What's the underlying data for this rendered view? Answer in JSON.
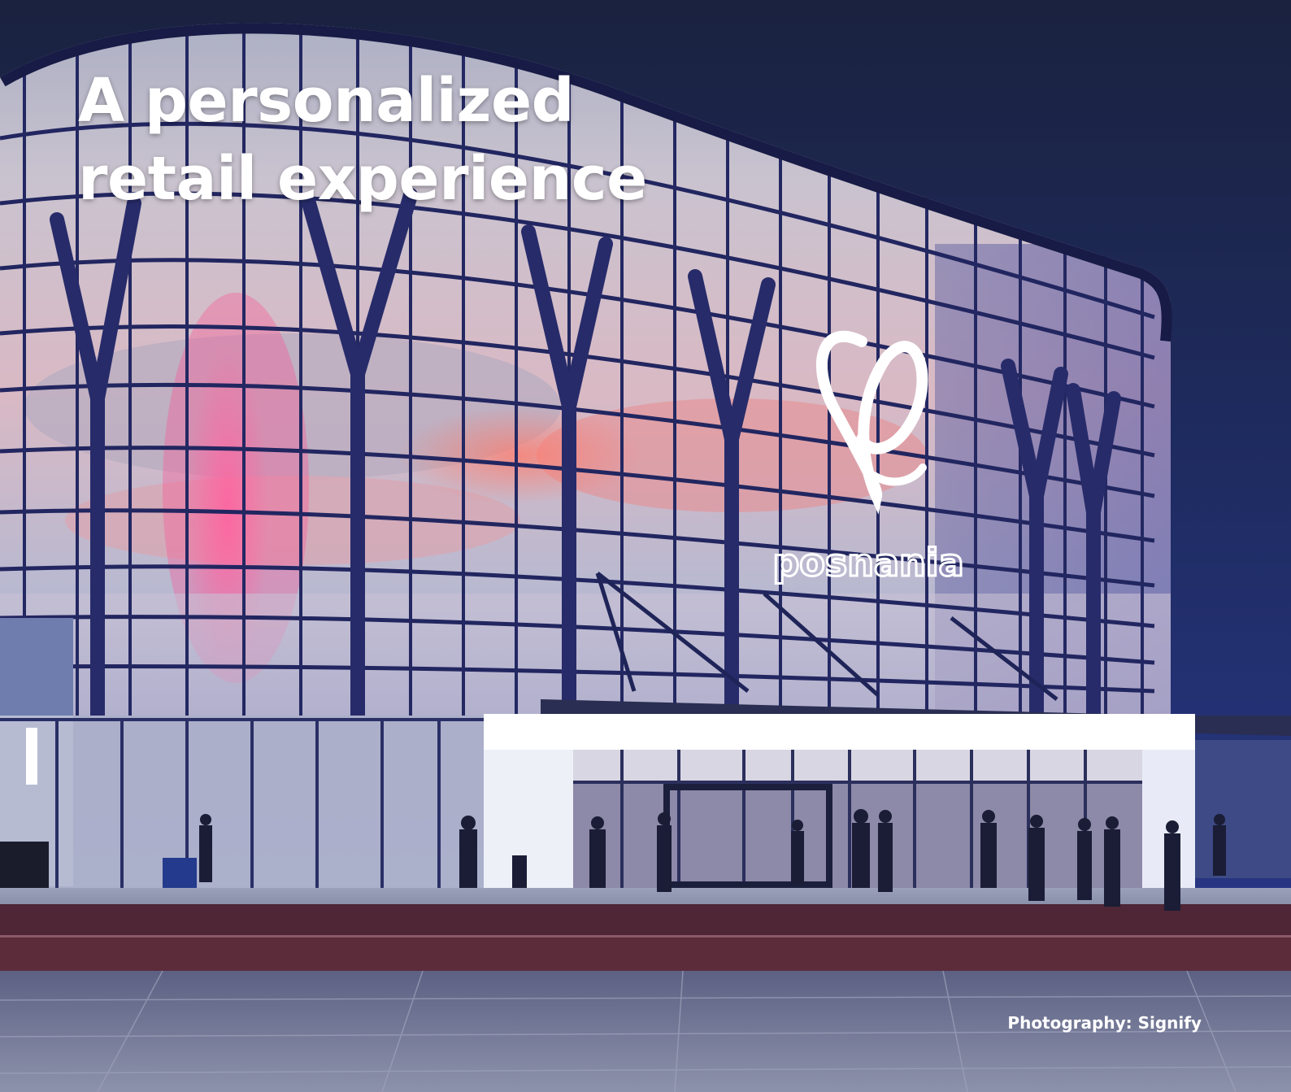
{
  "headline": {
    "line1": "A personalized",
    "line2": "retail experience"
  },
  "photo": {
    "sign_text": "posnania",
    "credit": "Photography: Signify"
  },
  "colors": {
    "sky": "#1c2548",
    "glass_warm": "#e9c9c7",
    "frame": "#1e2462",
    "canopy": "#ffffff",
    "plaza": "#6f7590",
    "steps": "#4a2230"
  }
}
